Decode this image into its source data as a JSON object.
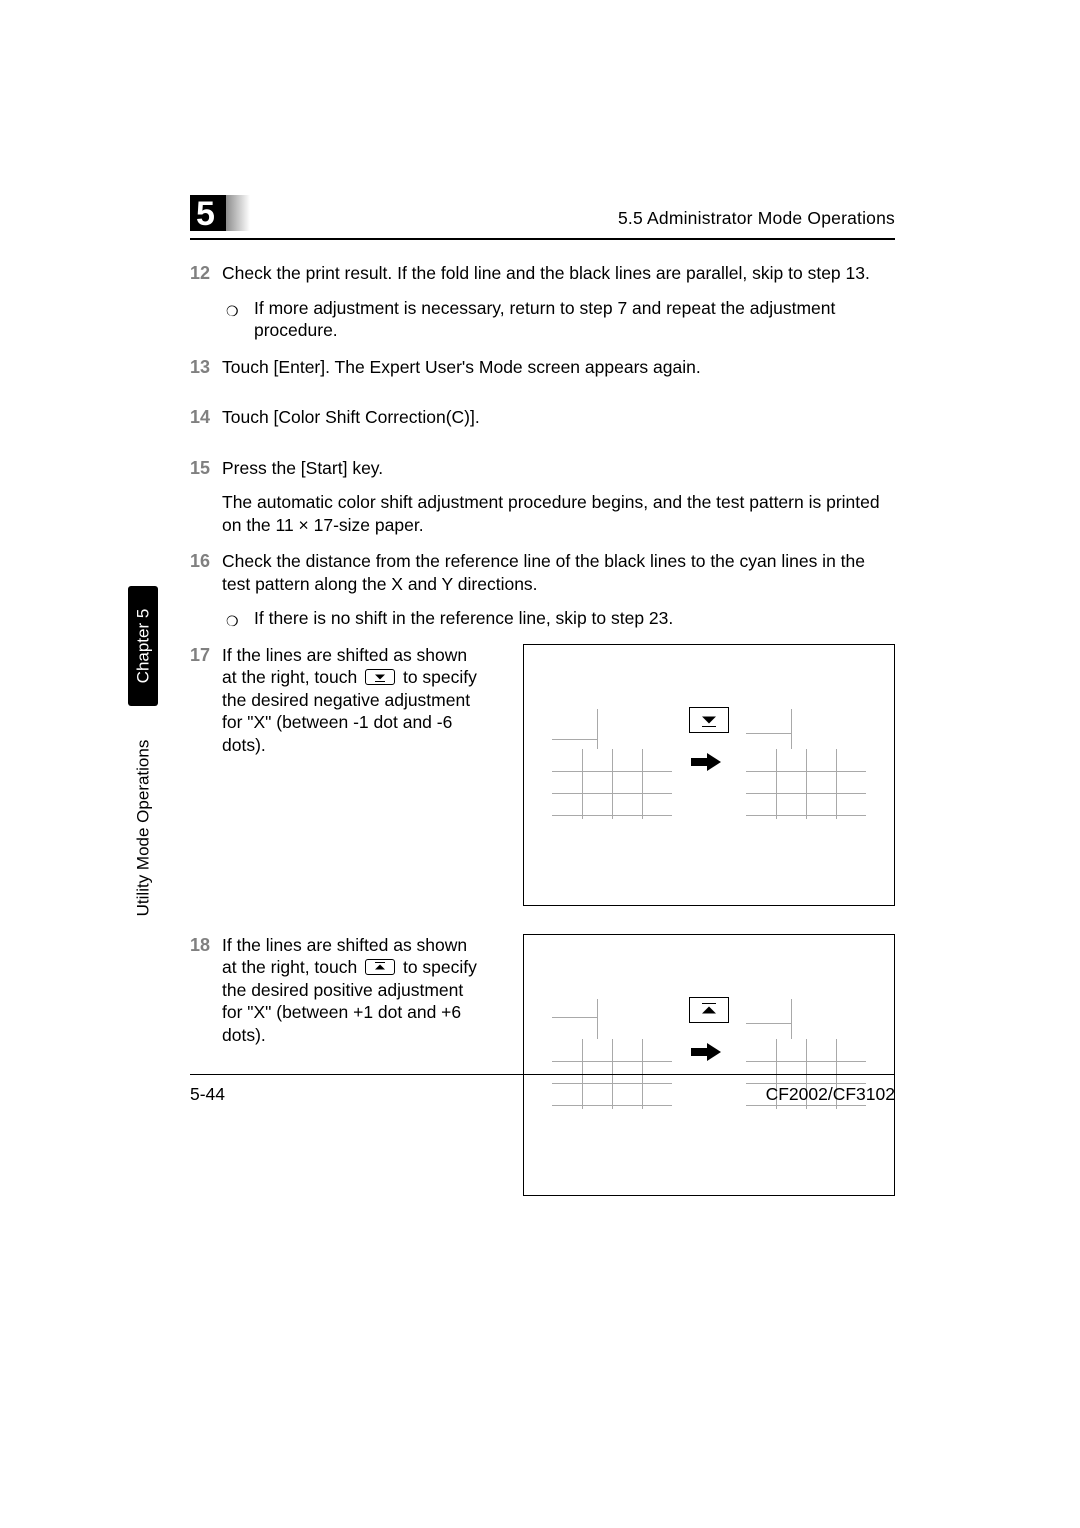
{
  "header": {
    "chapter_number": "5",
    "section_title": "5.5 Administrator Mode Operations"
  },
  "sidebar": {
    "chapter_label": "Chapter 5",
    "section_label": "Utility Mode Operations"
  },
  "steps": {
    "s12": {
      "num": "12",
      "text": "Check the print result. If the fold line and the black lines are parallel, skip to step 13.",
      "sub": "If more adjustment is necessary, return to step 7 and repeat the adjustment procedure."
    },
    "s13": {
      "num": "13",
      "text": "Touch [Enter]. The Expert User's Mode screen appears again."
    },
    "s14": {
      "num": "14",
      "text": "Touch [Color Shift Correction(C)]."
    },
    "s15": {
      "num": "15",
      "text": "Press the [Start] key.",
      "after": "The automatic color shift adjustment procedure begins, and the test pattern is printed on the 11 × 17-size paper."
    },
    "s16": {
      "num": "16",
      "text": "Check the distance from the reference line of the black lines to the cyan lines in the test pattern along the X and Y directions.",
      "sub": "If there is no shift in the reference line, skip to step 23."
    },
    "s17": {
      "num": "17",
      "pre": "If the lines are shifted as shown at the right, touch ",
      "post": " to specify the desired negative adjustment for \"X\" (between -1 dot and -6 dots)."
    },
    "s18": {
      "num": "18",
      "pre": "If the lines are shifted as shown at the right, touch ",
      "post": " to specify the desired positive adjustment for \"X\" (between +1 dot and +6 dots)."
    }
  },
  "footer": {
    "page": "5-44",
    "model": "CF2002/CF3102"
  }
}
